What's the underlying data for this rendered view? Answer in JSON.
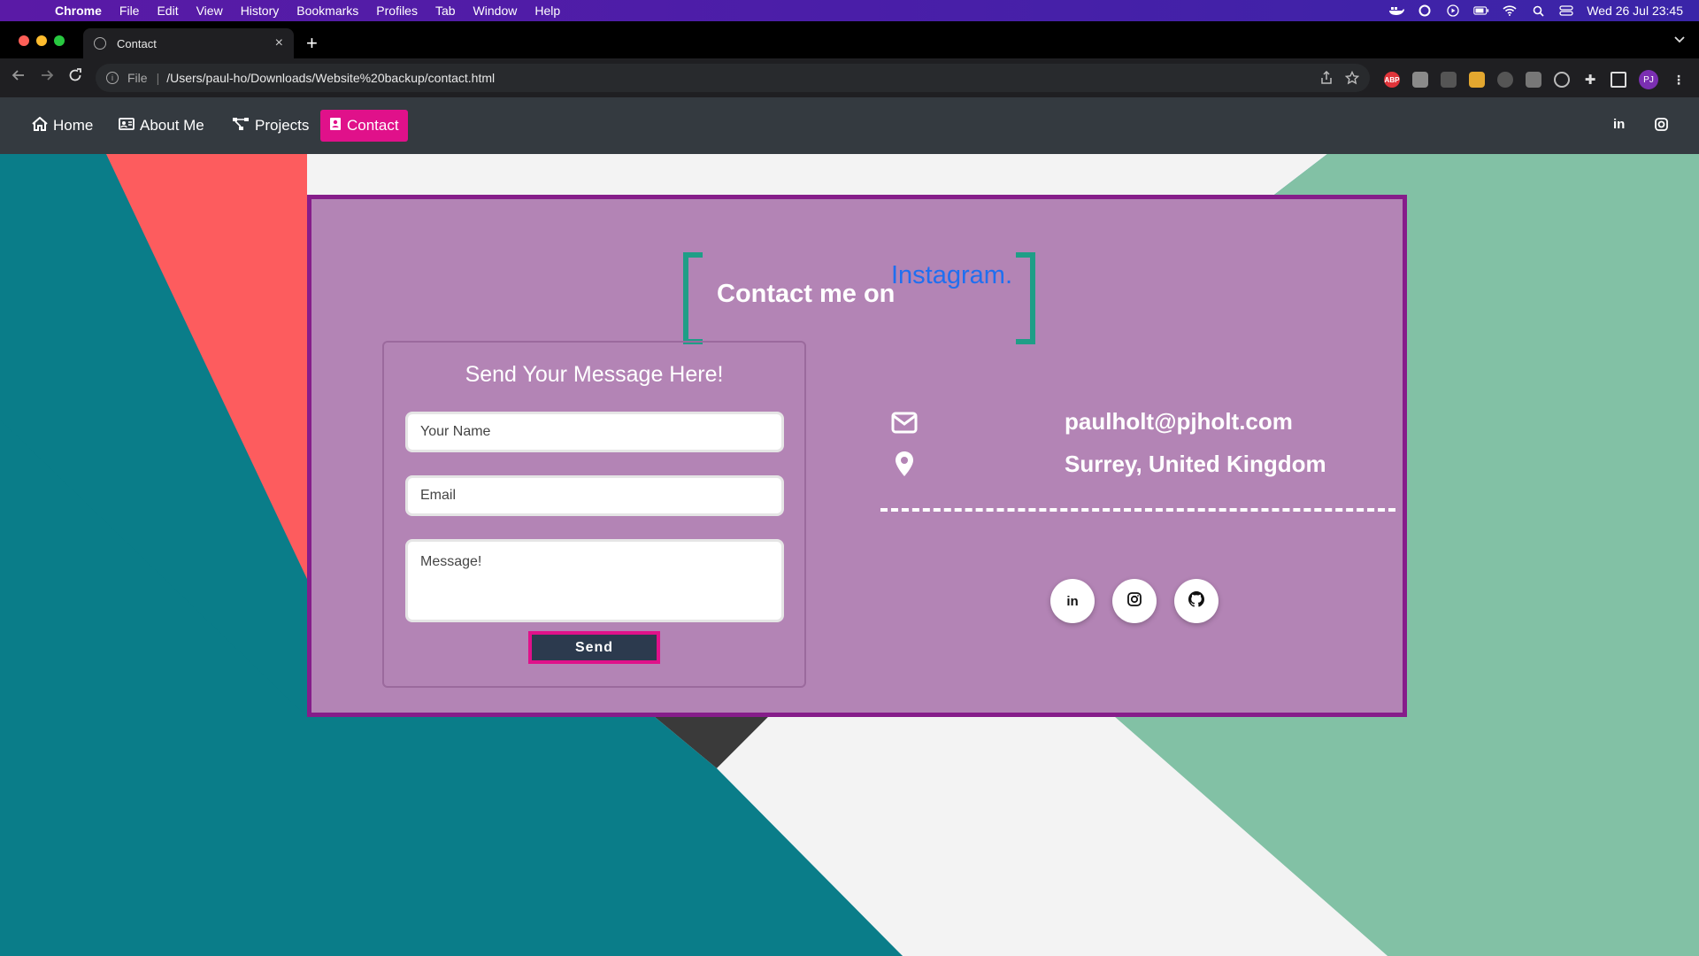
{
  "menubar": {
    "items": [
      "Chrome",
      "File",
      "Edit",
      "View",
      "History",
      "Bookmarks",
      "Profiles",
      "Tab",
      "Window",
      "Help"
    ],
    "clock": "Wed 26 Jul  23:45"
  },
  "browser": {
    "tab_title": "Contact",
    "url_scheme": "File",
    "url": "/Users/paul-ho/Downloads/Website%20backup/contact.html",
    "profile_initials": "PJ"
  },
  "site_nav": {
    "home": "Home",
    "about": "About Me",
    "projects": "Projects",
    "contact": "Contact",
    "linkedin_glyph": "in",
    "active_color": "#e0118a"
  },
  "heading": {
    "prefix": "Contact me on",
    "link": "Instagram."
  },
  "form": {
    "title": "Send Your Message Here!",
    "name_placeholder": "Your Name",
    "email_placeholder": "Email",
    "message_placeholder": "Message!",
    "send_label": "Send"
  },
  "contact_info": {
    "email": "paulholt@pjholt.com",
    "location": "Surrey, United Kingdom"
  },
  "social": {
    "linkedin_glyph": "in"
  }
}
